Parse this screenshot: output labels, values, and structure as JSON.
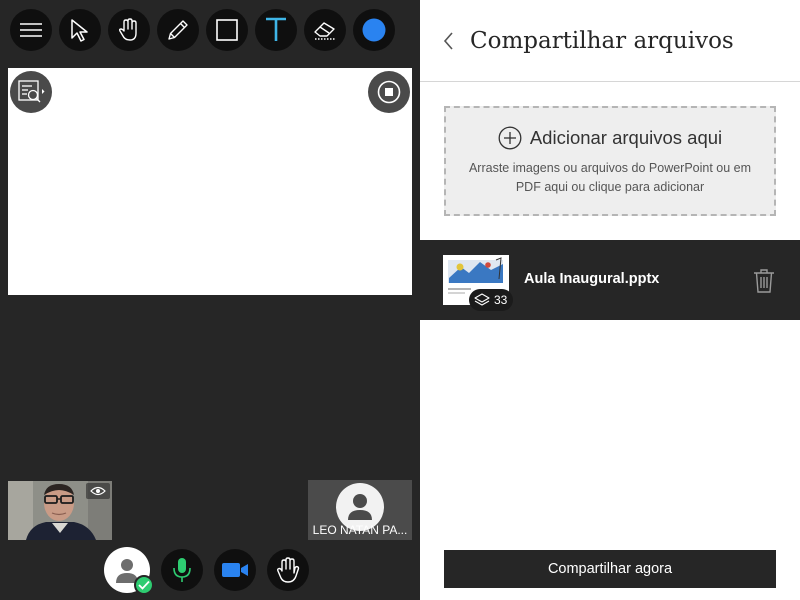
{
  "toolbar": {
    "tools": [
      {
        "icon": "menu-icon"
      },
      {
        "icon": "pointer-icon"
      },
      {
        "icon": "hand-pan-icon"
      },
      {
        "icon": "pencil-icon"
      },
      {
        "icon": "rectangle-icon"
      },
      {
        "icon": "text-icon",
        "color": "#3fb6e8"
      },
      {
        "icon": "eraser-icon"
      },
      {
        "icon": "color-picker-icon",
        "color": "#2a83f0"
      }
    ]
  },
  "whiteboard": {
    "left_button_icon": "zoom-fit-icon",
    "right_button_icon": "stop-icon"
  },
  "videos": {
    "peer_name": "LEO NATAN PA..."
  },
  "controls": {
    "status_color": "#2ecc71",
    "camera_color": "#2a83f0",
    "mic_color": "#2ecc71"
  },
  "panel": {
    "title": "Compartilhar arquivos",
    "dropzone_title": "Adicionar arquivos aqui",
    "dropzone_subtitle": "Arraste imagens ou arquivos do PowerPoint ou em PDF aqui ou clique para adicionar",
    "file": {
      "name": "Aula Inaugural.pptx",
      "slide_count": "33"
    },
    "share_button": "Compartilhar agora"
  }
}
